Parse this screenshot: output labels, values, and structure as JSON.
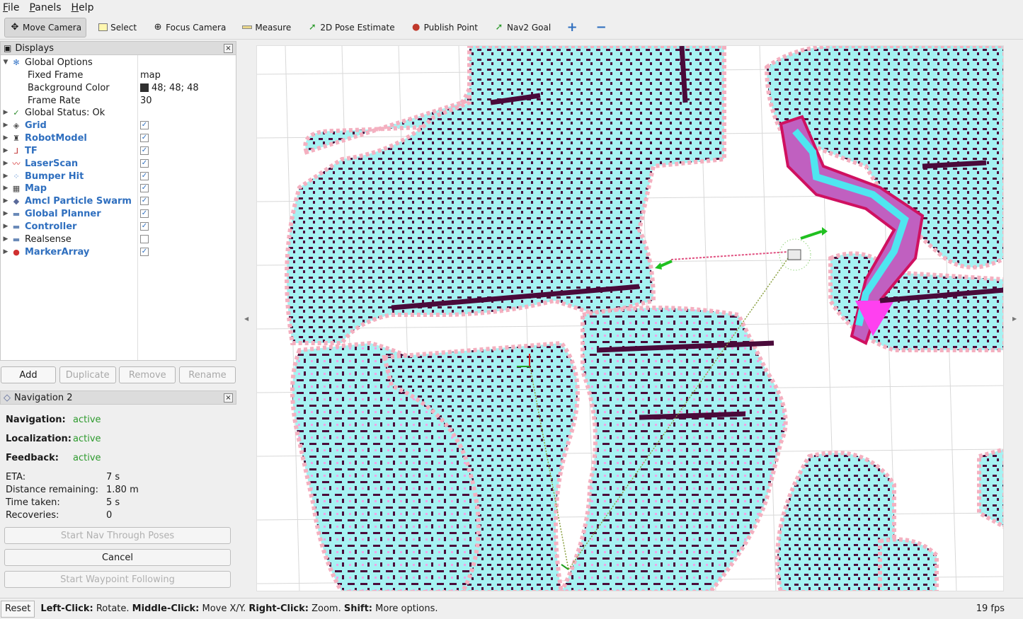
{
  "menu": [
    "File",
    "Panels",
    "Help"
  ],
  "toolbar": {
    "move_camera": "Move Camera",
    "select": "Select",
    "focus_camera": "Focus Camera",
    "measure": "Measure",
    "pose_estimate": "2D Pose Estimate",
    "publish_point": "Publish Point",
    "nav2_goal": "Nav2 Goal"
  },
  "displays": {
    "title": "Displays",
    "global_options": "Global Options",
    "fixed_frame_label": "Fixed Frame",
    "fixed_frame_value": "map",
    "bg_color_label": "Background Color",
    "bg_color_value": "48; 48; 48",
    "frame_rate_label": "Frame Rate",
    "frame_rate_value": "30",
    "global_status": "Global Status: Ok",
    "items": [
      {
        "label": "Grid",
        "checked": true
      },
      {
        "label": "RobotModel",
        "checked": true
      },
      {
        "label": "TF",
        "checked": true
      },
      {
        "label": "LaserScan",
        "checked": true
      },
      {
        "label": "Bumper Hit",
        "checked": true
      },
      {
        "label": "Map",
        "checked": true
      },
      {
        "label": "Amcl Particle Swarm",
        "checked": true
      },
      {
        "label": "Global Planner",
        "checked": true
      },
      {
        "label": "Controller",
        "checked": true
      },
      {
        "label": "Realsense",
        "checked": false
      },
      {
        "label": "MarkerArray",
        "checked": true
      }
    ],
    "buttons": {
      "add": "Add",
      "duplicate": "Duplicate",
      "remove": "Remove",
      "rename": "Rename"
    }
  },
  "nav2": {
    "title": "Navigation 2",
    "navigation_label": "Navigation:",
    "navigation_value": "active",
    "localization_label": "Localization:",
    "localization_value": "active",
    "feedback_label": "Feedback:",
    "feedback_value": "active",
    "eta_label": "ETA:",
    "eta_value": "7 s",
    "distance_label": "Distance remaining:",
    "distance_value": "1.80 m",
    "time_label": "Time taken:",
    "time_value": "5 s",
    "recoveries_label": "Recoveries:",
    "recoveries_value": "0",
    "start_nav_through_poses": "Start Nav Through Poses",
    "cancel": "Cancel",
    "start_waypoint": "Start Waypoint Following"
  },
  "status": {
    "reset": "Reset",
    "left_click": "Left-Click:",
    "left_click_text": " Rotate. ",
    "middle_click": "Middle-Click:",
    "middle_click_text": " Move X/Y. ",
    "right_click": "Right-Click:",
    "right_click_text": " Zoom. ",
    "shift": "Shift:",
    "shift_text": " More options.",
    "fps": "19 fps"
  },
  "colors": {
    "costmap_inflation": "#a6f2f2",
    "obstacle": "#4a0a3a",
    "halo": "#f4b0c0",
    "path": "#d01060",
    "accent_blue": "#2f6fbf",
    "status_green": "#2d9a2d"
  }
}
